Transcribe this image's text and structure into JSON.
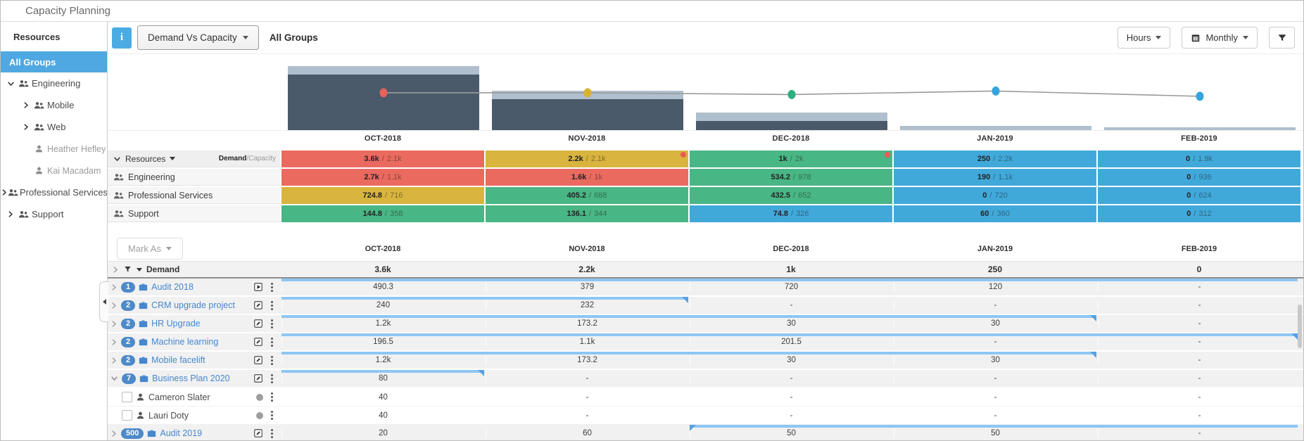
{
  "window": {
    "title": "Capacity Planning"
  },
  "sidebar": {
    "heading": "Resources",
    "items": [
      {
        "label": "All Groups",
        "selected": true
      },
      {
        "label": "Engineering",
        "icon": "group",
        "chevron": "down",
        "indent": 0
      },
      {
        "label": "Mobile",
        "icon": "group",
        "chevron": "right",
        "indent": 1
      },
      {
        "label": "Web",
        "icon": "group",
        "chevron": "right",
        "indent": 1
      },
      {
        "label": "Heather Hefley",
        "icon": "person",
        "chevron": "none",
        "indent": 1,
        "muted": true
      },
      {
        "label": "Kai Macadam",
        "icon": "person",
        "chevron": "none",
        "indent": 1,
        "muted": true
      },
      {
        "label": "Professional Services",
        "icon": "group",
        "chevron": "right",
        "indent": 0
      },
      {
        "label": "Support",
        "icon": "group",
        "chevron": "right",
        "indent": 0
      }
    ]
  },
  "toolbar": {
    "view_dropdown": "Demand Vs Capacity",
    "group_label": "All Groups",
    "units_dropdown": "Hours",
    "period_dropdown": "Monthly",
    "icons": [
      "info-icon",
      "calendar-icon",
      "filter-icon"
    ]
  },
  "months": [
    "OCT-2018",
    "NOV-2018",
    "DEC-2018",
    "JAN-2019",
    "FEB-2019"
  ],
  "chart_data": {
    "type": "combo",
    "categories": [
      "OCT-2018",
      "NOV-2018",
      "DEC-2018",
      "JAN-2019",
      "FEB-2019"
    ],
    "series": [
      {
        "name": "Demand",
        "type": "bar",
        "values": [
          3600,
          2200,
          1000,
          250,
          0
        ]
      },
      {
        "name": "Capacity",
        "type": "line",
        "values": [
          2100,
          2100,
          2000,
          2200,
          1900
        ]
      }
    ],
    "point_statuses": [
      "critical",
      "warning",
      "ok",
      "info",
      "info"
    ],
    "ylim": [
      0,
      4270
    ],
    "legend": "none",
    "grid": false
  },
  "colors": {
    "status_cell": {
      "red": "#EA6A60",
      "yellow": "#D9B43E",
      "green": "#49B685",
      "blue": "#41A9DA"
    },
    "point": {
      "critical": "#E8615A",
      "warning": "#D9B230",
      "ok": "#2FAE7F",
      "info": "#36A4DC"
    },
    "bar_dark": "#4A5A6A",
    "bar_light": "#AFBFCE",
    "timeline_bar": "#8EC6F4",
    "accent_blue": "#4BACE4"
  },
  "capacity_table": {
    "header_label": "Resources",
    "legend_primary": "Demand",
    "legend_secondary": "/Capacity",
    "rows": [
      {
        "name": "Resources",
        "is_header": true,
        "cells": [
          [
            "3.6k",
            "2.1k"
          ],
          [
            "2.2k",
            "2.1k"
          ],
          [
            "1k",
            "2k"
          ],
          [
            "250",
            "2.2k"
          ],
          [
            "0",
            "1.9k"
          ]
        ],
        "statuses": [
          "red",
          "yellow",
          "green",
          "blue",
          "blue"
        ],
        "alert_dots": [
          false,
          true,
          true,
          false,
          false
        ]
      },
      {
        "name": "Engineering",
        "cells": [
          [
            "2.7k",
            "1.1k"
          ],
          [
            "1.6k",
            "1k"
          ],
          [
            "534.2",
            "978"
          ],
          [
            "190",
            "1.1k"
          ],
          [
            "0",
            "936"
          ]
        ],
        "statuses": [
          "red",
          "red",
          "green",
          "blue",
          "blue"
        ],
        "alert_dots": [
          false,
          false,
          false,
          false,
          false
        ]
      },
      {
        "name": "Professional Services",
        "cells": [
          [
            "724.8",
            "716"
          ],
          [
            "405.2",
            "688"
          ],
          [
            "432.5",
            "652"
          ],
          [
            "0",
            "720"
          ],
          [
            "0",
            "624"
          ]
        ],
        "statuses": [
          "yellow",
          "green",
          "green",
          "blue",
          "blue"
        ],
        "alert_dots": [
          false,
          false,
          false,
          false,
          false
        ]
      },
      {
        "name": "Support",
        "cells": [
          [
            "144.8",
            "358"
          ],
          [
            "136.1",
            "344"
          ],
          [
            "74.8",
            "326"
          ],
          [
            "60",
            "360"
          ],
          [
            "0",
            "312"
          ]
        ],
        "statuses": [
          "green",
          "green",
          "blue",
          "blue",
          "blue"
        ],
        "alert_dots": [
          false,
          false,
          false,
          false,
          false
        ]
      }
    ]
  },
  "assignment_table": {
    "mark_as_label": "Mark As",
    "demand_row": {
      "label": "Demand",
      "values": [
        "3.6k",
        "2.2k",
        "1k",
        "250",
        "0"
      ]
    },
    "rows": [
      {
        "type": "project",
        "badge": "1",
        "name": "Audit 2018",
        "action": "play",
        "expanded": false,
        "values": [
          "490.3",
          "379",
          "720",
          "120",
          "-"
        ],
        "bar": {
          "from": 0,
          "to": 5,
          "start_notch": false,
          "end_notch": false
        }
      },
      {
        "type": "project",
        "badge": "2",
        "name": "CRM upgrade project",
        "action": "edit",
        "expanded": false,
        "values": [
          "240",
          "232",
          "-",
          "-",
          "-"
        ],
        "bar": {
          "from": 0,
          "to": 2,
          "start_notch": false,
          "end_notch": true
        }
      },
      {
        "type": "project",
        "badge": "2",
        "name": "HR Upgrade",
        "action": "edit",
        "expanded": false,
        "values": [
          "1.2k",
          "173.2",
          "30",
          "30",
          "-"
        ],
        "bar": {
          "from": 0,
          "to": 4,
          "start_notch": false,
          "end_notch": true
        }
      },
      {
        "type": "project",
        "badge": "2",
        "name": "Machine learning",
        "action": "edit",
        "expanded": false,
        "values": [
          "196.5",
          "1.1k",
          "201.5",
          "-",
          "-"
        ],
        "bar": {
          "from": 0,
          "to": 5,
          "start_notch": false,
          "end_notch": true
        }
      },
      {
        "type": "project",
        "badge": "2",
        "name": "Mobile facelift",
        "action": "edit",
        "expanded": false,
        "values": [
          "1.2k",
          "173.2",
          "30",
          "30",
          "-"
        ],
        "bar": {
          "from": 0,
          "to": 4,
          "start_notch": false,
          "end_notch": true
        }
      },
      {
        "type": "project",
        "badge": "7",
        "name": "Business Plan 2020",
        "action": "edit",
        "expanded": true,
        "values": [
          "80",
          "-",
          "-",
          "-",
          "-"
        ],
        "bar": {
          "from": 0,
          "to": 1,
          "start_notch": false,
          "end_notch": true
        }
      },
      {
        "type": "person",
        "name": "Cameron Slater",
        "values": [
          "40",
          "-",
          "-",
          "-",
          "-"
        ],
        "bar": null
      },
      {
        "type": "person",
        "name": "Lauri Doty",
        "values": [
          "40",
          "-",
          "-",
          "-",
          "-"
        ],
        "bar": null
      },
      {
        "type": "project",
        "badge": "500",
        "name": "Audit 2019",
        "action": "edit",
        "expanded": false,
        "values": [
          "20",
          "60",
          "50",
          "50",
          "-"
        ],
        "bar": {
          "from": 2,
          "to": 5,
          "start_notch": true,
          "end_notch": false
        }
      }
    ]
  }
}
